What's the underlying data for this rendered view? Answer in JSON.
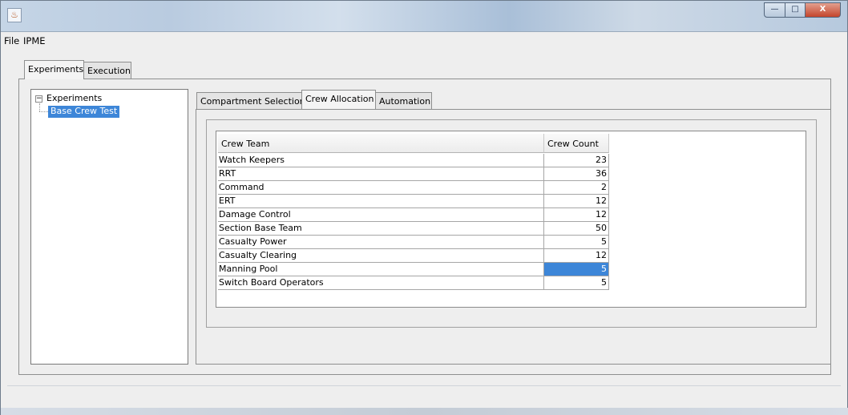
{
  "window": {
    "close_glyph": "X",
    "max_glyph": "□",
    "min_glyph": "—",
    "icon_glyph": "♨"
  },
  "menu": {
    "items": [
      "File",
      "IPME"
    ]
  },
  "outer_tabs": [
    {
      "label": "Experiments",
      "selected": true
    },
    {
      "label": "Execution",
      "selected": false
    }
  ],
  "tree": {
    "expander": "−",
    "root_label": "Experiments",
    "children": [
      {
        "label": "Base Crew Test",
        "selected": true
      }
    ]
  },
  "inner_tabs": [
    {
      "label": "Compartment Selection",
      "selected": false
    },
    {
      "label": "Crew Allocation",
      "selected": true
    },
    {
      "label": "Automation",
      "selected": false
    }
  ],
  "table": {
    "headers": [
      "Crew Team",
      "Crew Count"
    ],
    "rows": [
      {
        "team": "Watch Keepers",
        "count": "23"
      },
      {
        "team": "RRT",
        "count": "36"
      },
      {
        "team": "Command",
        "count": "2"
      },
      {
        "team": "ERT",
        "count": "12"
      },
      {
        "team": "Damage Control",
        "count": "12"
      },
      {
        "team": "Section Base Team",
        "count": "50"
      },
      {
        "team": "Casualty Power",
        "count": "5"
      },
      {
        "team": "Casualty Clearing",
        "count": "12"
      },
      {
        "team": "Manning Pool",
        "count": "5"
      },
      {
        "team": "Switch Board Operators",
        "count": "5"
      }
    ],
    "selected_row": 8
  },
  "colors": {
    "selection": "#3d86d8"
  }
}
